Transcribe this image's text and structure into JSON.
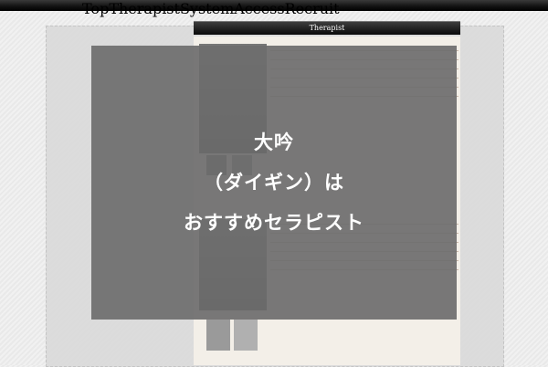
{
  "nav": {
    "items": [
      "Top",
      "Therapist",
      "System",
      "Access",
      "Recruit"
    ]
  },
  "section": {
    "title": "Therapist"
  },
  "overlay": {
    "line1": "大吟",
    "line2": "（ダイギン）は",
    "line3": "おすすめセラピスト"
  }
}
